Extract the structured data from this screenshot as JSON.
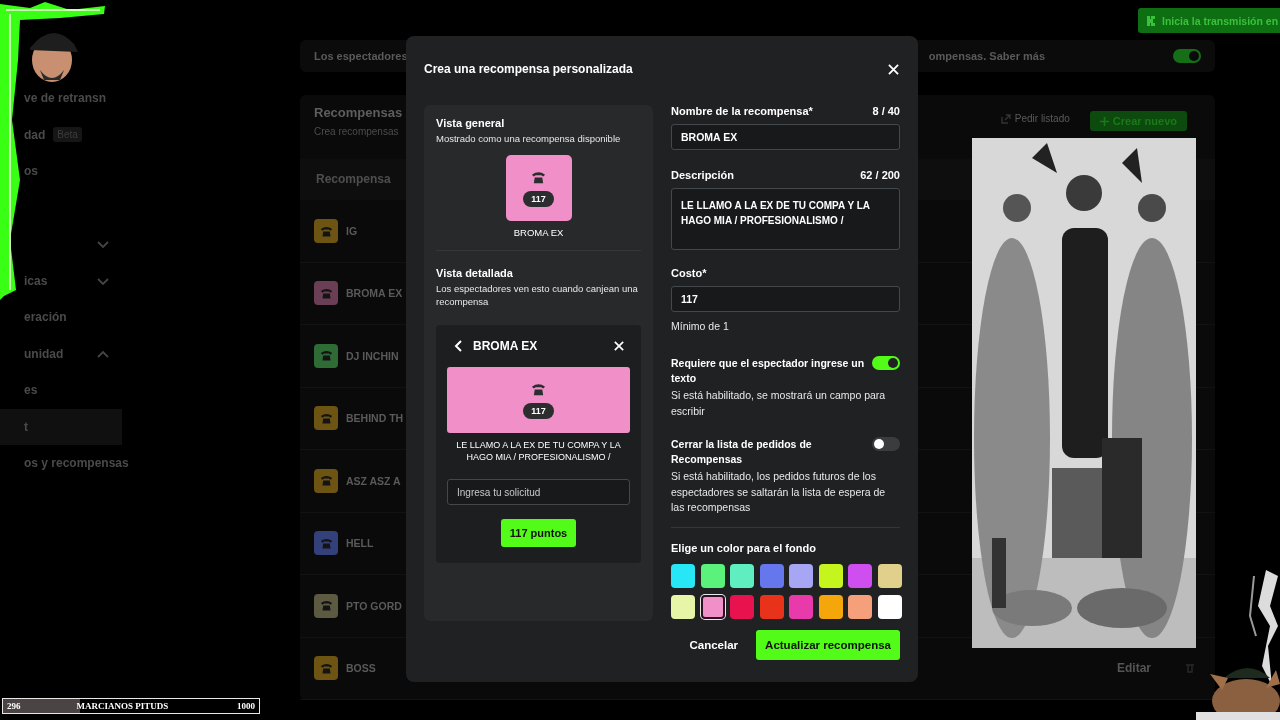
{
  "overlay": {
    "countdown_badge": "Inicia la transmisión en",
    "goal_bar": {
      "current": "296",
      "title": "MARCIANOS PITUDS",
      "target": "1000",
      "level": 0.3
    }
  },
  "sidebar": {
    "items": [
      {
        "label": "ve de retransn",
        "selected": false
      },
      {
        "label": "dad",
        "badge": "Beta",
        "selected": false
      },
      {
        "label": "os",
        "selected": false
      },
      {
        "expandable": true,
        "expanded": false,
        "spacer_before": true,
        "selected": false
      },
      {
        "label": "icas",
        "expandable": true,
        "expanded": false,
        "selected": false
      },
      {
        "label": "eración",
        "selected": false
      },
      {
        "label": "unidad",
        "expandable": true,
        "expanded": true,
        "selected": false
      },
      {
        "label": "es",
        "selected": false
      },
      {
        "label": "t",
        "selected": true
      },
      {
        "label": "os y recompensas",
        "selected": false
      }
    ]
  },
  "banner": {
    "text_left": "Los espectadores",
    "text_right": "ompensas. Saber más",
    "on": true
  },
  "rewards": {
    "title": "Recompensas",
    "subtitle": "Crea recompensas",
    "actions": [
      "Pedir listado",
      "Crear nuevo"
    ],
    "column_1": "Recompensa",
    "rows": [
      {
        "name": "IG",
        "color": "#6e5412"
      },
      {
        "name": "BROMA EX",
        "color": "#6a3f55"
      },
      {
        "name": "DJ INCHIN",
        "color": "#2e6b35"
      },
      {
        "name": "BEHIND TH",
        "color": "#6e5412"
      },
      {
        "name": "ASZ ASZ A",
        "color": "#6e5412"
      },
      {
        "name": "HELL",
        "color": "#33407a"
      },
      {
        "name": "PTO GORD",
        "color": "#5c5a40"
      },
      {
        "name": "BOSS",
        "color": "#6e5412",
        "action": "Editar"
      }
    ]
  },
  "modal": {
    "title": "Crea una recompensa personalizada",
    "preview": {
      "general_title": "Vista general",
      "general_sub": "Mostrado como una recompensa disponible",
      "cost": "117",
      "name": "BROMA EX",
      "detail_title": "Vista detallada",
      "detail_sub": "Los espectadores ven esto cuando canjean una recompensa",
      "detail_header": "BROMA EX",
      "detail_cost": "117",
      "detail_text": "LE LLAMO A LA EX DE TU COMPA Y LA HAGO MIA / PROFESIONALISMO /",
      "input_placeholder": "Ingresa tu solicitud",
      "redeem_button": "117 puntos"
    },
    "form": {
      "name_label": "Nombre de la recompensa*",
      "name_count": "8 / 40",
      "name_value": "BROMA EX",
      "desc_label": "Descripción",
      "desc_count": "62 / 200",
      "desc_value": "LE LLAMO A LA EX DE TU COMPA Y LA HAGO MIA / PROFESIONALISMO /",
      "cost_label": "Costo*",
      "cost_value": "117",
      "cost_hint": "Mínimo de 1",
      "toggles": [
        {
          "title": "Requiere que el espectador ingrese un texto",
          "description": "Si está habilitado, se mostrará un campo para escribir",
          "on": true
        },
        {
          "title": "Cerrar la lista de pedidos de Recompensas",
          "description": "Si está habilitado, los pedidos futuros de los espectadores se saltarán la lista de espera de las recompensas",
          "on": false
        }
      ],
      "color_label": "Elige un color para el fondo",
      "colors": [
        {
          "color": "#27e6f5",
          "selected": false
        },
        {
          "color": "#5af27a",
          "selected": false
        },
        {
          "color": "#5eeec0",
          "selected": false
        },
        {
          "color": "#6677ee",
          "selected": false
        },
        {
          "color": "#a6a6f5",
          "selected": false
        },
        {
          "color": "#c6f51e",
          "selected": false
        },
        {
          "color": "#cf4ef0",
          "selected": false
        },
        {
          "color": "#e0d08c",
          "selected": false
        },
        {
          "color": "#e6f5a6",
          "selected": false
        },
        {
          "color": "#f08fc8",
          "selected": true
        },
        {
          "color": "#e8124f",
          "selected": false
        },
        {
          "color": "#e8321a",
          "selected": false
        },
        {
          "color": "#e83aaa",
          "selected": false
        },
        {
          "color": "#f5a60a",
          "selected": false
        },
        {
          "color": "#f5a07a",
          "selected": false
        },
        {
          "color": "#ffffff",
          "selected": false
        }
      ]
    },
    "buttons": {
      "cancel": "Cancelar",
      "submit": "Actualizar recompensa"
    }
  }
}
